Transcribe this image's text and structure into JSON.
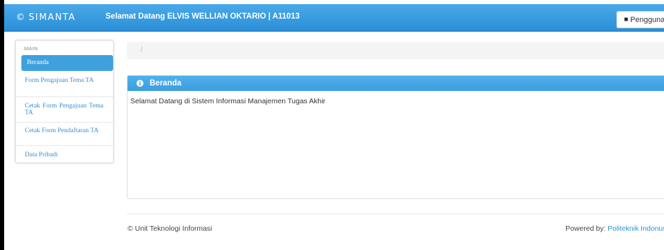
{
  "navbar": {
    "brand": "SIMANTA",
    "welcome": "Selamat Datang ELVIS WELLIAN OKTARIO |  A11013",
    "user_menu_label": "Pengguna"
  },
  "sidebar": {
    "section_label": "MAIN",
    "items": [
      {
        "label": "Beranda",
        "active": true
      },
      {
        "label": "Form Pengajuan Tema TA",
        "active": false
      },
      {
        "label": "Cetak Form Pengajuan Tema TA",
        "active": false
      },
      {
        "label": "Cetak Form Pendaftaran TA",
        "active": false
      },
      {
        "label": "Data Pribadi",
        "active": false
      }
    ]
  },
  "breadcrumb": {
    "separator": "/"
  },
  "panel": {
    "title": "Beranda",
    "body": "Selamat Datang di Sistem Informasi Manajemen Tugas Akhir"
  },
  "footer": {
    "left": "© Unit Teknologi Informasi",
    "powered_by": "Powered by: ",
    "link_text": "Politeknik Indonusa"
  },
  "colors": {
    "navbar": "#2b8fd6",
    "accent": "#3fa0de",
    "link": "#2a93d5"
  }
}
